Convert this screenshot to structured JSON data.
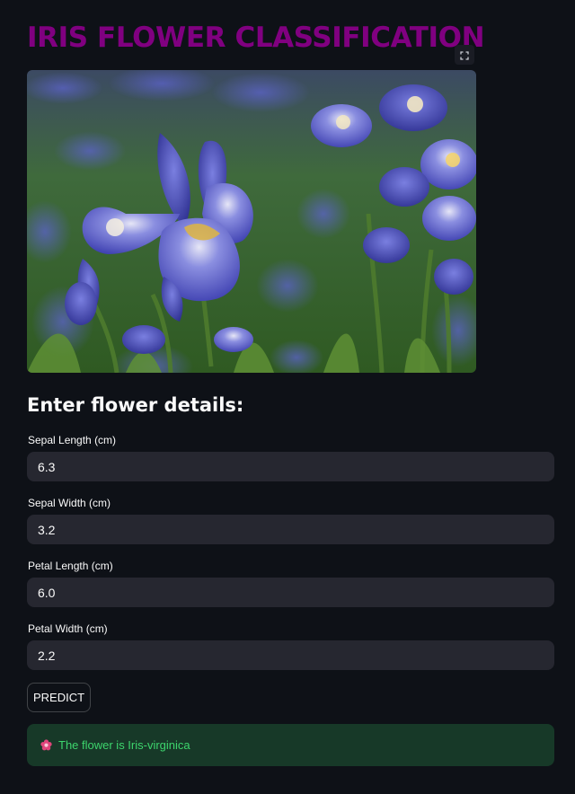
{
  "header": {
    "title": "IRIS FLOWER CLASSIFICATION",
    "fullscreen_icon": "expand-icon"
  },
  "hero_image": {
    "subject": "iris-flowers-photo"
  },
  "form": {
    "heading": "Enter flower details:",
    "fields": [
      {
        "label": "Sepal Length (cm)",
        "value": "6.3"
      },
      {
        "label": "Sepal Width (cm)",
        "value": "3.2"
      },
      {
        "label": "Petal Length (cm)",
        "value": "6.0"
      },
      {
        "label": "Petal Width (cm)",
        "value": "2.2"
      }
    ],
    "predict_label": "PREDICT"
  },
  "result": {
    "icon": "flower-icon",
    "message": "The flower is Iris-virginica"
  },
  "colors": {
    "background": "#0e1117",
    "title": "#800080",
    "input_bg": "#262730",
    "success_bg": "#173928",
    "success_text": "#3dd56d"
  }
}
